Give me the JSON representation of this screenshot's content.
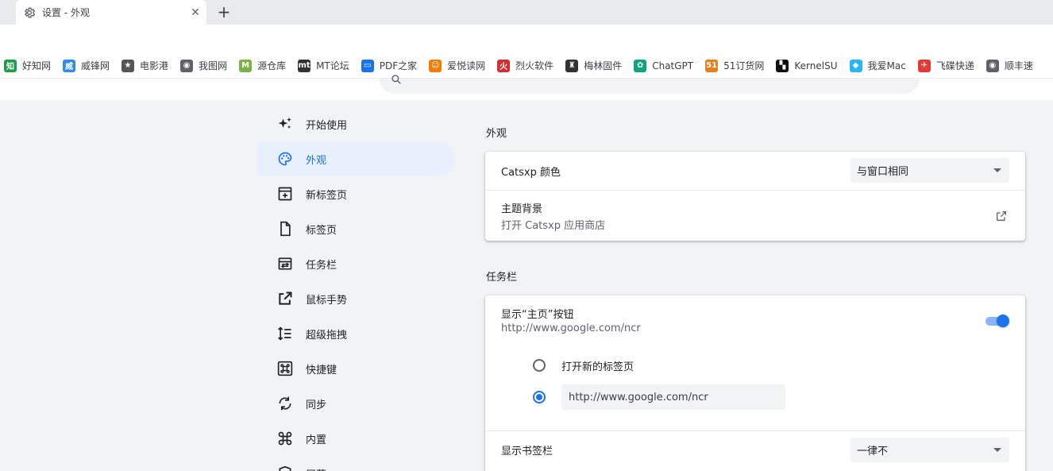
{
  "tab": {
    "title": "设置 - 外观",
    "close": "✕",
    "new_tab": "+"
  },
  "bookmarks": [
    {
      "label": "好知网",
      "icon": "zhi-icon",
      "glyph": "知",
      "color": "#1e9e4a"
    },
    {
      "label": "威锋网",
      "icon": "weifeng-icon",
      "glyph": "威",
      "color": "#2d8cf0"
    },
    {
      "label": "电影港",
      "icon": "movie-icon",
      "glyph": "★",
      "color": "#555555"
    },
    {
      "label": "我图网",
      "icon": "globe-icon",
      "glyph": "◉",
      "color": "#5f6368"
    },
    {
      "label": "源仓库",
      "icon": "m-icon",
      "glyph": "M",
      "color": "#7cb342"
    },
    {
      "label": "MT论坛",
      "icon": "mt-icon",
      "glyph": "mt",
      "color": "#333333"
    },
    {
      "label": "PDF之家",
      "icon": "laptop-icon",
      "glyph": "▭",
      "color": "#1a73e8"
    },
    {
      "label": "爱悦读网",
      "icon": "smile-icon",
      "glyph": "☺",
      "color": "#f57c00"
    },
    {
      "label": "烈火软件",
      "icon": "fire-icon",
      "glyph": "火",
      "color": "#d32f2f"
    },
    {
      "label": "梅林固件",
      "icon": "merlin-icon",
      "glyph": "♜",
      "color": "#333333"
    },
    {
      "label": "ChatGPT",
      "icon": "chatgpt-icon",
      "glyph": "✿",
      "color": "#10a37f"
    },
    {
      "label": "51订货网",
      "icon": "order-icon",
      "glyph": "51",
      "color": "#e67e22"
    },
    {
      "label": "KernelSU",
      "icon": "kernelsu-icon",
      "glyph": "▚",
      "color": "#111111"
    },
    {
      "label": "我爱Mac",
      "icon": "mac-icon",
      "glyph": "◆",
      "color": "#29b6f6"
    },
    {
      "label": "飞碟快递",
      "icon": "ufo-icon",
      "glyph": "✈",
      "color": "#e53935"
    },
    {
      "label": "顺丰速",
      "icon": "globe-icon",
      "glyph": "◉",
      "color": "#5f6368"
    }
  ],
  "sidebar": {
    "items": [
      {
        "label": "开始使用",
        "icon": "sparkle-icon"
      },
      {
        "label": "外观",
        "icon": "palette-icon",
        "active": true
      },
      {
        "label": "新标签页",
        "icon": "new-tab-icon"
      },
      {
        "label": "标签页",
        "icon": "page-icon"
      },
      {
        "label": "任务栏",
        "icon": "taskbar-icon"
      },
      {
        "label": "鼠标手势",
        "icon": "open-external-icon"
      },
      {
        "label": "超级拖拽",
        "icon": "drag-icon"
      },
      {
        "label": "快捷键",
        "icon": "command-icon"
      },
      {
        "label": "同步",
        "icon": "sync-icon"
      },
      {
        "label": "内置",
        "icon": "builtin-icon"
      },
      {
        "label": "屏蔽",
        "icon": "shield-icon"
      }
    ]
  },
  "appearance": {
    "title": "外观",
    "color_label": "Catsxp 颜色",
    "color_value": "与窗口相同",
    "theme_label": "主题背景",
    "theme_sub": "打开 Catsxp 应用商店"
  },
  "taskbar": {
    "title": "任务栏",
    "home_label": "显示“主页”按钮",
    "home_sub": "http://www.google.com/ncr",
    "home_enabled": true,
    "radio_new_tab": "打开新的标签页",
    "radio_url_value": "http://www.google.com/ncr",
    "bookmarks_bar_label": "显示书签栏",
    "bookmarks_bar_value": "一律不"
  },
  "colors": {
    "accent": "#1a73e8",
    "active_bg": "#e8f0fe",
    "page_bg": "#f1f3f4"
  }
}
